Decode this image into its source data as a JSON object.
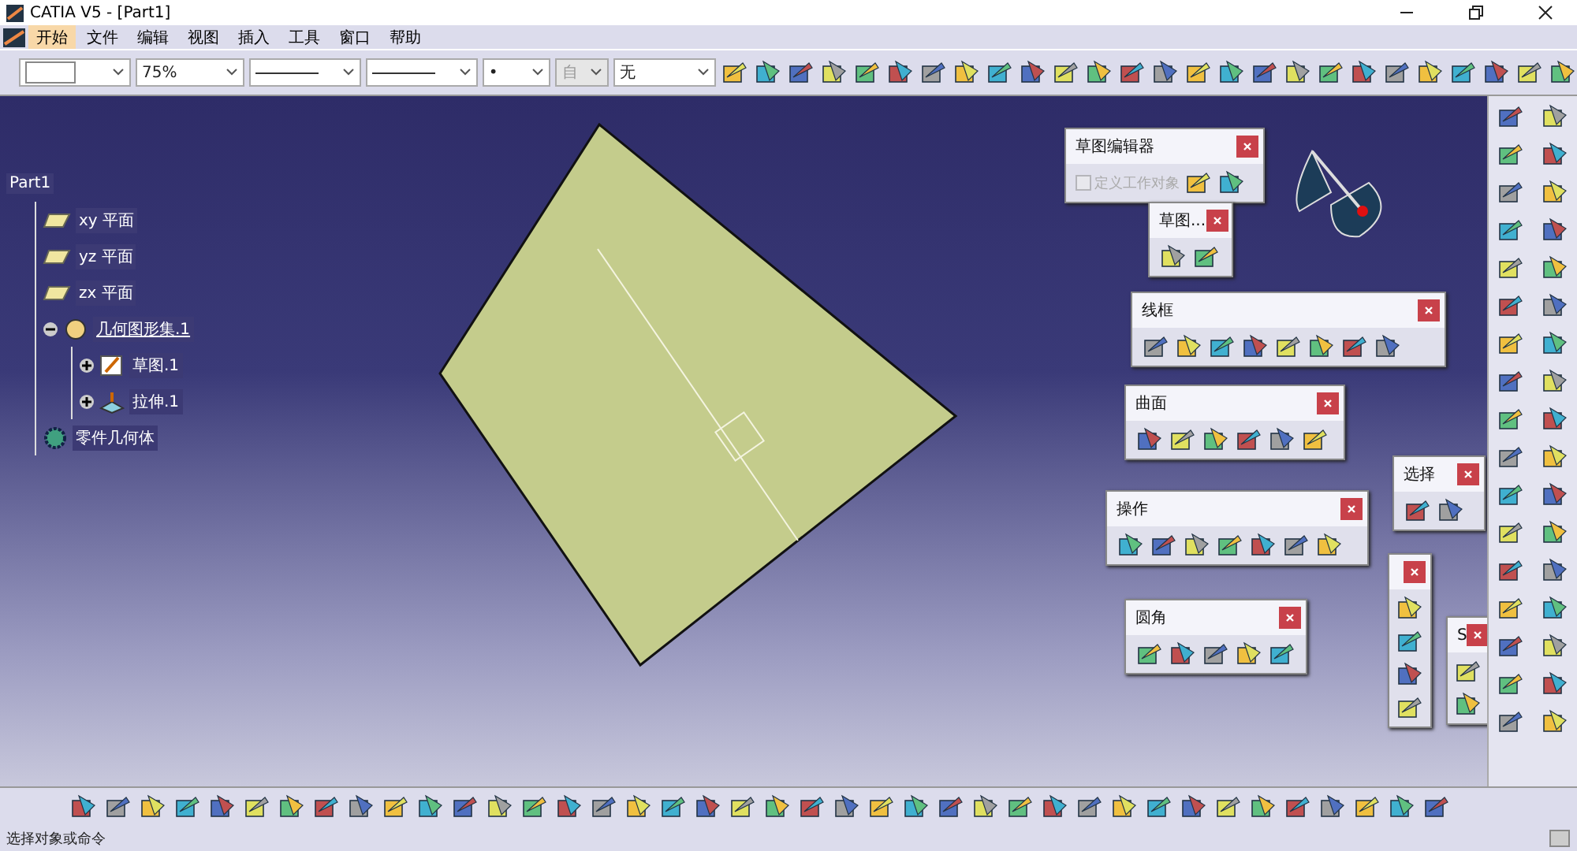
{
  "window": {
    "title": "CATIA V5 - [Part1]"
  },
  "menu": [
    {
      "label": "开始",
      "selected": true
    },
    {
      "label": "文件",
      "selected": false
    },
    {
      "label": "编辑",
      "selected": false
    },
    {
      "label": "视图",
      "selected": false
    },
    {
      "label": "插入",
      "selected": false
    },
    {
      "label": "工具",
      "selected": false
    },
    {
      "label": "窗口",
      "selected": false
    },
    {
      "label": "帮助",
      "selected": false
    }
  ],
  "toolbar": {
    "combos": [
      {
        "kind": "swatch",
        "disabled": false
      },
      {
        "kind": "text",
        "value": "75%",
        "disabled": false
      },
      {
        "kind": "line",
        "disabled": false
      },
      {
        "kind": "line",
        "disabled": false
      },
      {
        "kind": "text",
        "value": "•",
        "disabled": false
      },
      {
        "kind": "text",
        "value": "自",
        "disabled": true
      },
      {
        "kind": "text",
        "value": "无",
        "disabled": false
      }
    ]
  },
  "tree": {
    "label": "Part1",
    "children": [
      {
        "label": "xy 平面",
        "kind": "plane"
      },
      {
        "label": "yz 平面",
        "kind": "plane"
      },
      {
        "label": "zx 平面",
        "kind": "plane"
      },
      {
        "label": "几何图形集.1",
        "kind": "set",
        "expanded": true,
        "children": [
          {
            "label": "草图.1",
            "kind": "sketch",
            "expanded": false
          },
          {
            "label": "拉伸.1",
            "kind": "extrude",
            "expanded": false
          }
        ]
      },
      {
        "label": "零件几何体",
        "kind": "body"
      }
    ]
  },
  "floating_toolbars": [
    {
      "title": "草图编辑器",
      "kind": "horizontal",
      "checkbox": {
        "label": "定义工作对象",
        "checked": false,
        "disabled": true
      }
    },
    {
      "title": "草图...",
      "kind": "horizontal"
    },
    {
      "title": "线框",
      "kind": "horizontal"
    },
    {
      "title": "曲面",
      "kind": "horizontal"
    },
    {
      "title": "选择",
      "kind": "horizontal"
    },
    {
      "title": "操作",
      "kind": "horizontal"
    },
    {
      "title": "圆角",
      "kind": "horizontal"
    },
    {
      "kind": "vertical"
    },
    {
      "title": "S",
      "kind": "vertical"
    }
  ],
  "status_bar": {
    "text": "选择对象或命令"
  }
}
